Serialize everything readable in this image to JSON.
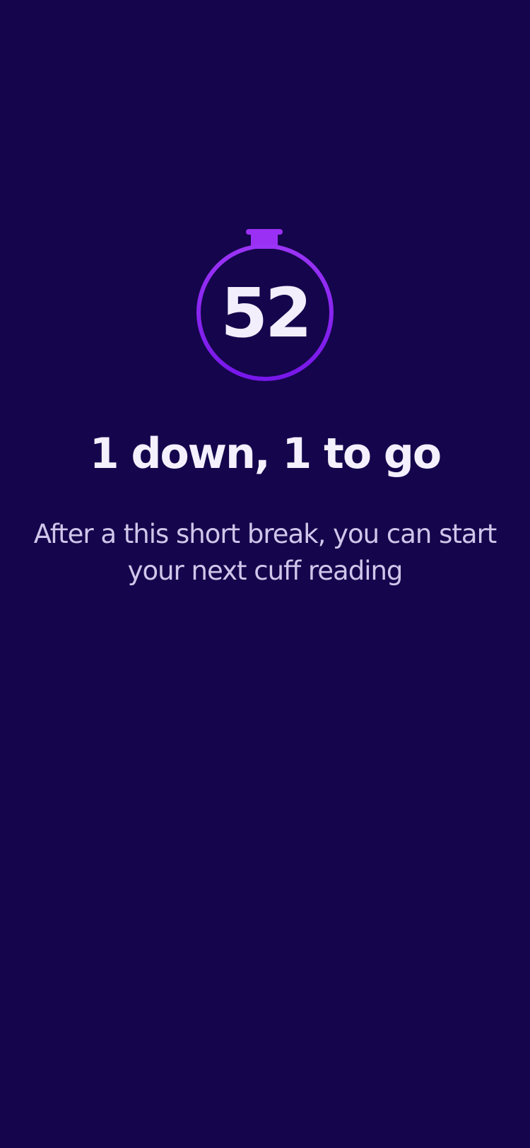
{
  "timer": {
    "seconds": "52",
    "ring_color": "#8a22f0",
    "icon": "stopwatch-icon"
  },
  "headline": "1 down, 1 to go",
  "message": "After a this short break, you can start your next cuff reading",
  "colors": {
    "background": "#15054c",
    "text_primary": "#f4f0fd",
    "text_secondary": "#cfc6ea",
    "accent": "#8a22f0"
  }
}
